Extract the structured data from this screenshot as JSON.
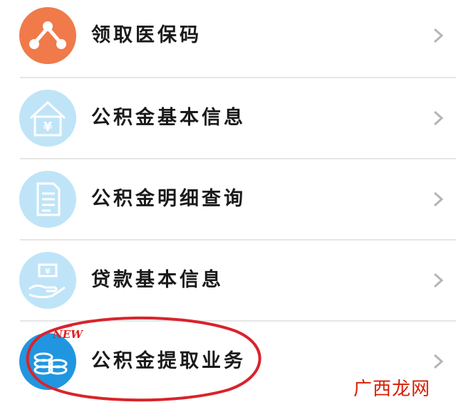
{
  "menu": {
    "items": [
      {
        "label": "领取医保码",
        "icon": "share-nodes-icon",
        "icon_color": "#f07a4a"
      },
      {
        "label": "公积金基本信息",
        "icon": "house-yen-icon",
        "icon_color": "#bfe4f8"
      },
      {
        "label": "公积金明细查询",
        "icon": "document-icon",
        "icon_color": "#bfe4f8"
      },
      {
        "label": "贷款基本信息",
        "icon": "hand-money-icon",
        "icon_color": "#bfe4f8"
      },
      {
        "label": "公积金提取业务",
        "icon": "coin-stack-icon",
        "icon_color": "#2196e0"
      }
    ],
    "new_badge": "NEW"
  },
  "annotation": {
    "circle_color": "#d8242c"
  },
  "watermark": "广西龙网",
  "colors": {
    "chevron": "#b5b5b5",
    "divider": "#e6e6e6"
  }
}
